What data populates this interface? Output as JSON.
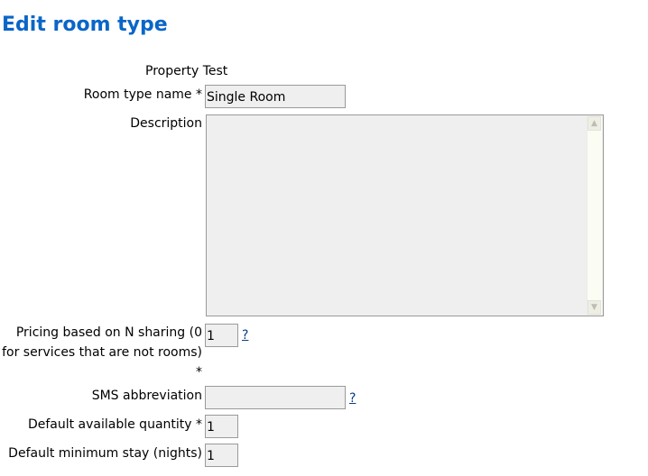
{
  "page": {
    "title": "Edit room type"
  },
  "form": {
    "property": {
      "label": "Property",
      "value": "Test"
    },
    "room_type_name": {
      "label": "Room type name *",
      "value": "Single Room"
    },
    "description": {
      "label": "Description",
      "value": ""
    },
    "pricing_sharing": {
      "label": "Pricing based on N sharing (0 for services that are not rooms) *",
      "value": "1",
      "help": "?"
    },
    "sms_abbreviation": {
      "label": "SMS abbreviation",
      "value": "",
      "help": "?"
    },
    "default_available_quantity": {
      "label": "Default available quantity *",
      "value": "1"
    },
    "default_minimum_stay": {
      "label": "Default minimum stay (nights)",
      "value": "1"
    }
  },
  "scrollbar": {
    "up_icon": "chevron-up-icon",
    "down_icon": "chevron-down-icon"
  },
  "colors": {
    "title": "#0a66c8",
    "input_bg": "#efefef",
    "link": "#0a3c8c"
  }
}
